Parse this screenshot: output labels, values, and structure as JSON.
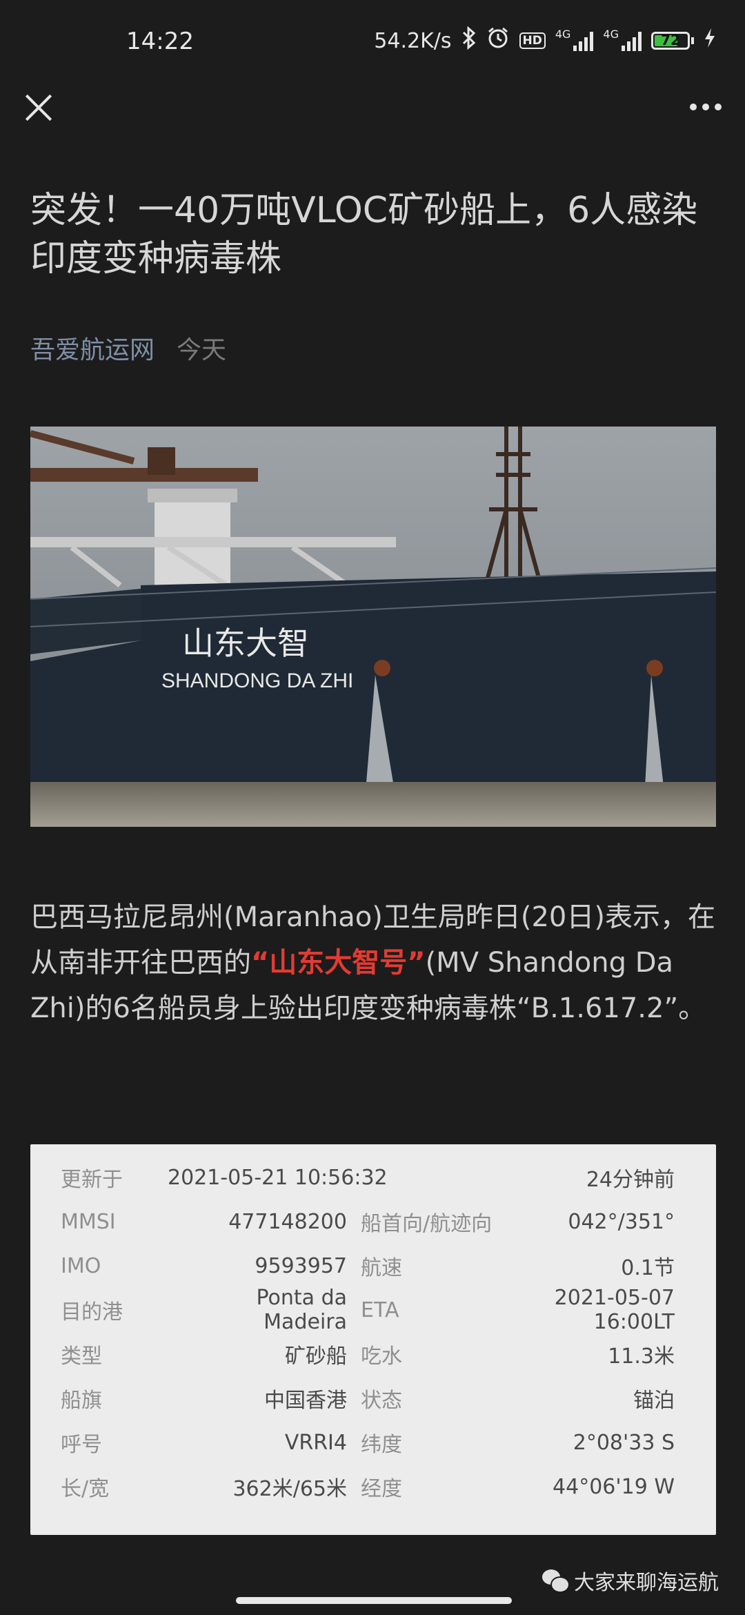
{
  "status_bar": {
    "time": "14:22",
    "net_speed": "54.2K/s",
    "battery": "72",
    "hd": "HD",
    "net1": "4G",
    "net2": "4G",
    "battery_level": 0.72
  },
  "article": {
    "title": "突发！一40万吨VLOC矿砂船上，6人感染印度变种病毒株",
    "source": "吾爱航运网",
    "date": "今天",
    "photo": {
      "hull_name_cn": "山东大智",
      "hull_name_en": "SHANDONG DA ZHI"
    },
    "body_before": "巴西马拉尼昂州(Maranhao)卫生局昨日(20日)表示，在从南非开往巴西的",
    "body_highlight": "“山东大智号”",
    "body_after": "(MV Shandong Da Zhi)的6名船员身上验出印度变种病毒株“B.1.617.2”。"
  },
  "ship_info": {
    "rows": [
      {
        "label1": "更新于",
        "value1": "2021-05-21 10:56:32",
        "label2": "",
        "value2": "24分钟前"
      },
      {
        "label1": "MMSI",
        "value1": "477148200",
        "label2": "船首向/航迹向",
        "value2": "042°/351°"
      },
      {
        "label1": "IMO",
        "value1": "9593957",
        "label2": "航速",
        "value2": "0.1节"
      },
      {
        "label1": "目的港",
        "value1": "Ponta da Madeira",
        "label2": "ETA",
        "value2": "2021-05-07 16:00LT"
      },
      {
        "label1": "类型",
        "value1": "矿砂船",
        "label2": "吃水",
        "value2": "11.3米"
      },
      {
        "label1": "船旗",
        "value1": "中国香港",
        "label2": "状态",
        "value2": "锚泊"
      },
      {
        "label1": "呼号",
        "value1": "VRRI4",
        "label2": "纬度",
        "value2": "2°08'33 S"
      },
      {
        "label1": "长/宽",
        "value1": "362米/65米",
        "label2": "经度",
        "value2": "44°06'19 W"
      }
    ]
  },
  "footer": {
    "handle": "大家来聊海运航"
  }
}
